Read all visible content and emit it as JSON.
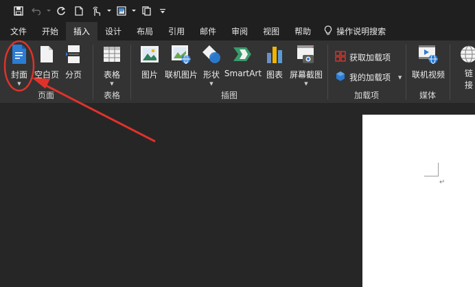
{
  "tabs": [
    {
      "label": "文件"
    },
    {
      "label": "开始"
    },
    {
      "label": "插入"
    },
    {
      "label": "设计"
    },
    {
      "label": "布局"
    },
    {
      "label": "引用"
    },
    {
      "label": "邮件"
    },
    {
      "label": "审阅"
    },
    {
      "label": "视图"
    },
    {
      "label": "帮助"
    }
  ],
  "tell_me": "操作说明搜索",
  "ribbon": {
    "pages_group": {
      "label": "页面",
      "cover": "封面",
      "blank": "空白页",
      "break": "分页"
    },
    "table_group": {
      "label": "表格",
      "table": "表格"
    },
    "illustrations_group": {
      "label": "插图",
      "picture": "图片",
      "online_picture": "联机图片",
      "shapes": "形状",
      "smartart": "SmartArt",
      "chart": "图表",
      "screenshot": "屏幕截图"
    },
    "addins_group": {
      "label": "加载项",
      "get_addins": "获取加载项",
      "my_addins": "我的加载项"
    },
    "media_group": {
      "label": "媒体",
      "online_video": "联机视频"
    },
    "links_partial": {
      "label_top": "链",
      "label_bottom": "接"
    }
  },
  "colors": {
    "accent_red": "#e0322a",
    "word_blue": "#2b7cd3",
    "ribbon_bg": "#333333",
    "title_bg": "#1f1f1f"
  }
}
